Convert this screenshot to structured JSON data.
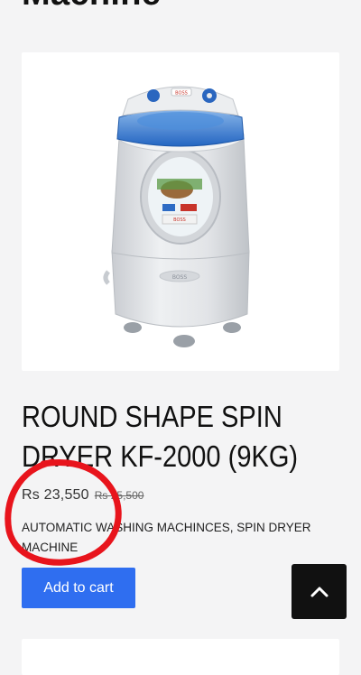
{
  "page": {
    "heading": "Machine"
  },
  "product": {
    "title": "ROUND SHAPE SPIN DRYER KF-2000 (9KG)",
    "price_current": "Rs 23,550",
    "price_old": "Rs 25,500",
    "categories": [
      {
        "label": "AUTOMATIC WASHING MACHINCES"
      },
      {
        "label": "SPIN DRYER MACHINE"
      }
    ],
    "category_separator": ", ",
    "add_to_cart_label": "Add to cart",
    "brand_logo_text": "BOSS",
    "image_colors": {
      "lid_blue": "#2f78d0",
      "body_grey": "#e3e5e8",
      "window_frame": "#d9dbe0"
    }
  },
  "controls": {
    "scroll_top_icon": "chevron-up-icon"
  },
  "colors": {
    "accent": "#2f6ef0",
    "annotation_red": "#e8141c"
  }
}
